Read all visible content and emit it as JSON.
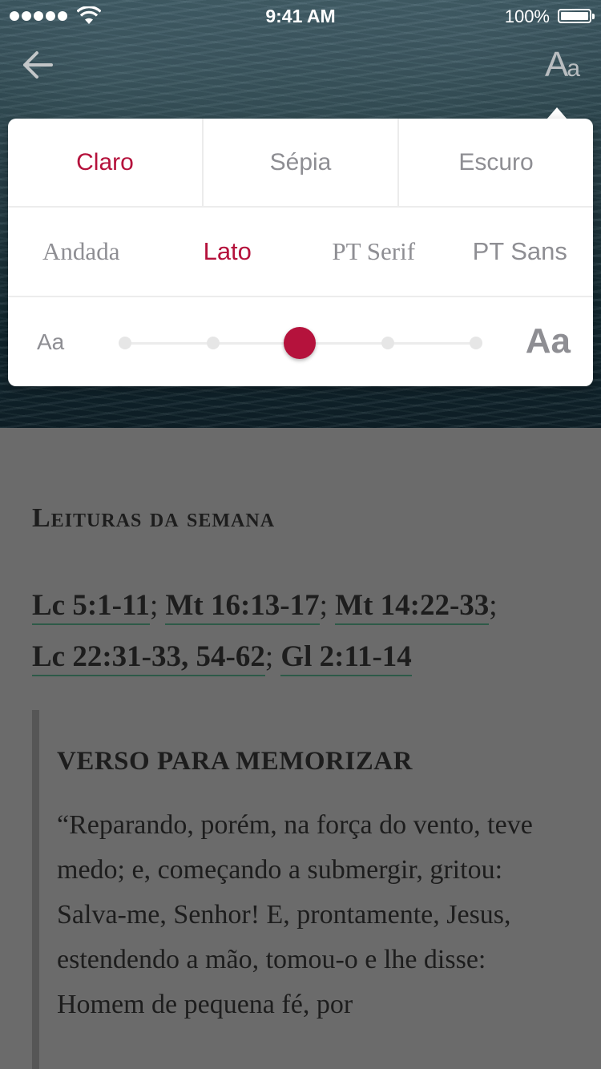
{
  "status_bar": {
    "time": "9:41 AM",
    "battery": "100%"
  },
  "nav": {
    "back_icon": "arrow-left-icon",
    "settings_icon_big": "A",
    "settings_icon_small": "a"
  },
  "reader_settings": {
    "themes": [
      "Claro",
      "Sépia",
      "Escuro"
    ],
    "selected_theme": "Claro",
    "fonts": [
      "Andada",
      "Lato",
      "PT Serif",
      "PT Sans"
    ],
    "selected_font": "Lato",
    "size_small_label": "Aa",
    "size_large_label": "Aa",
    "size_steps": 5,
    "size_selected_index": 2
  },
  "content": {
    "section_title": "Leituras da semana",
    "references": [
      "Lc 5:1-11",
      "Mt 16:13-17",
      "Mt 14:22-33",
      "Lc 22:31-33, 54-62",
      "Gl 2:11-14"
    ],
    "memory_title": "VERSO PARA MEMORIZAR",
    "memory_text": "“Reparando, porém, na força do vento, teve medo; e, começando a submergir, gritou: Salva-me, Senhor! E, prontamente, Jesus, estendendo a mão, tomou-o e lhe disse: Homem de pequena fé, por"
  },
  "colors": {
    "accent": "#b5123c",
    "link_underline": "#2e5a48",
    "overlay": "#6b6b6b"
  }
}
